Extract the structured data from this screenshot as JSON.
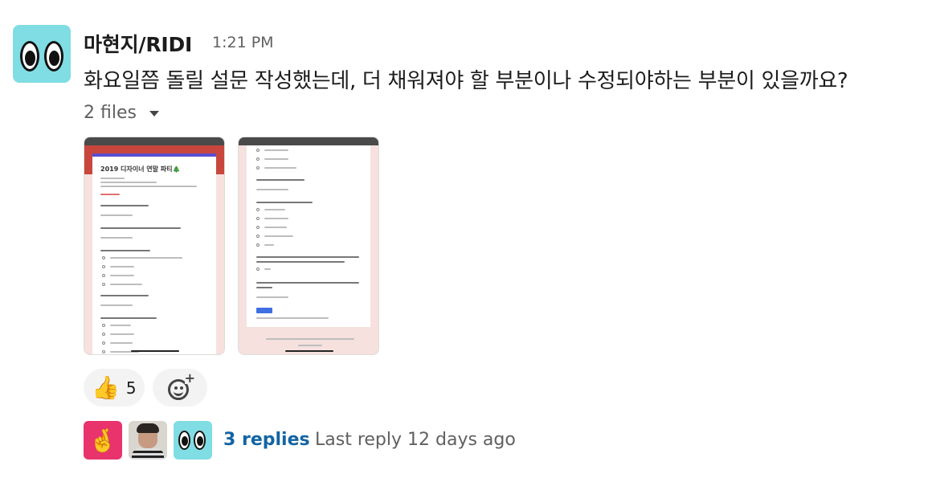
{
  "message": {
    "sender": "마현지/RIDI",
    "time": "1:21 PM",
    "text": "화요일쯤 돌릴 설문 작성했는데, 더 채워져야 할 부분이나 수정되야하는 부분이 있을까요?"
  },
  "files": {
    "toggle_label": "2 files",
    "attachments": [
      {
        "form_title": "2019 디자이너 연말 파티🎄",
        "icon": "form-screenshot-1"
      },
      {
        "icon": "form-screenshot-2"
      }
    ]
  },
  "reactions": [
    {
      "emoji": "👍",
      "count": "5"
    }
  ],
  "thread": {
    "reply_avatars": [
      "🤞",
      "person-photo",
      "eyes-emoji-avatar"
    ],
    "replies_label": "3 replies",
    "last_reply": "Last reply 12 days ago"
  },
  "colors": {
    "link": "#1264a3",
    "muted": "#616061",
    "avatar_bg": "#7fdde3",
    "form_header": "#c9463d"
  }
}
